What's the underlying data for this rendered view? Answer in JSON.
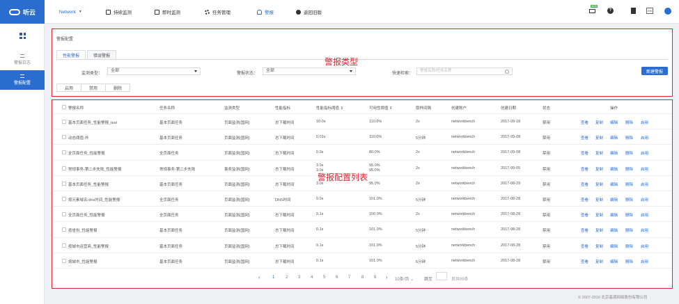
{
  "app": {
    "logo_text": "听云"
  },
  "nav": {
    "network": "Network",
    "continuous": "持续监测",
    "instant": "即时监测",
    "tasks": "任务管理",
    "alerts": "警报",
    "back": "返回旧版"
  },
  "topright": {
    "badge": "NEW",
    "lang": "EN"
  },
  "sidebar": {
    "items": [
      {
        "label": "警报日志"
      },
      {
        "label": "警报配置"
      }
    ]
  },
  "panel": {
    "breadcrumb": "警报配置",
    "tabs": [
      "性能警报",
      "错误警报"
    ],
    "filters": {
      "monitor_type_label": "监测类型：",
      "monitor_type_value": "全部",
      "status_label": "警报状态：",
      "status_value": "全部",
      "quick_search_label": "快速检索：",
      "search_placeholder": "警报名称/任务名称"
    },
    "buttons": {
      "enable": "启用",
      "disable": "禁用",
      "delete": "删除",
      "new": "新建警报"
    },
    "annotation_type": "警报类型",
    "annotation_list": "警报配置列表"
  },
  "table": {
    "headers": [
      "警报名称",
      "任务名称",
      "监测类型",
      "性能指标",
      "性能指标阈值 ⇕",
      "可用性阈值 ⇕",
      "取样间隔",
      "创建账户",
      "创建日期",
      "状态",
      "操作"
    ],
    "ops": [
      "查看",
      "复制",
      "编辑",
      "删除",
      "启用"
    ],
    "rows": [
      {
        "name": "基本页面任务_性能警报_test",
        "task": "基本页面任务",
        "type": "页面监测(国网)",
        "metric": "总下载时间",
        "threshold": "10.0s",
        "avail": "110.0%",
        "interval": "2x",
        "account": "networkbench",
        "date": "2017-09-18",
        "status": "禁用"
      },
      {
        "name": "动态阈值-外",
        "task": "基本页面任务",
        "type": "页面监测(国网)",
        "metric": "总下载时间",
        "threshold": "0.01s",
        "avail": "110.0%",
        "interval": "5分钟",
        "account": "networkbench",
        "date": "2017-09-08",
        "status": "禁用"
      },
      {
        "name": "全页面任务_性能警报",
        "task": "全页面任务",
        "type": "页面监测(国网)",
        "metric": "总下载时间",
        "threshold": "0.0s",
        "avail": "80.0%",
        "interval": "2x",
        "account": "networkbench",
        "date": "2017-09-08",
        "status": "禁用"
      },
      {
        "name": "常规事务-第二步失败_性能警报",
        "task": "常规事务-第二步失败",
        "type": "事务监测(国网)",
        "metric": "总下载时间",
        "threshold": "3.0s",
        "threshold2": "3.0s",
        "avail": "95.0%",
        "avail2": "95.0%",
        "interval": "2x",
        "account": "networkbench",
        "date": "2017-09-05",
        "status": "禁用"
      },
      {
        "name": "基本页面任务_性能警报",
        "task": "基本页面任务",
        "type": "页面监测(国网)",
        "metric": "总下载时间",
        "threshold": "3.0s",
        "avail": "95.0%",
        "interval": "2x",
        "account": "networkbench",
        "date": "2017-08-29",
        "status": "禁用"
      },
      {
        "name": "按元素域名-dns时间_性能警报",
        "task": "全页面任务",
        "type": "页面监测(国网)",
        "metric": "DNS时间",
        "threshold": "0.0s",
        "avail": "101.0%",
        "interval": "5分钟",
        "account": "networkbench",
        "date": "2017-08-28",
        "status": "禁用"
      },
      {
        "name": "全页面任务_性能警报",
        "task": "全页面任务",
        "type": "页面监测(国网)",
        "metric": "总下载时间",
        "threshold": "0.1s",
        "avail": "100.0%",
        "interval": "2x",
        "account": "networkbench",
        "date": "2017-08-28",
        "status": "禁用"
      },
      {
        "name": "按省份_性能警报",
        "task": "基本页面任务",
        "type": "页面监测(国网)",
        "metric": "总下载时间",
        "threshold": "0.1s",
        "avail": "101.0%",
        "interval": "5分钟",
        "account": "networkbench",
        "date": "2017-08-28",
        "status": "禁用"
      },
      {
        "name": "按城市运营商_性能警报",
        "task": "基本页面任务",
        "type": "页面监测(国网)",
        "metric": "总下载时间",
        "threshold": "0.1s",
        "avail": "101.0%",
        "interval": "5分钟",
        "account": "networkbench",
        "date": "2017-08-28",
        "status": "禁用"
      },
      {
        "name": "按城市_性能警报",
        "task": "基本页面任务",
        "type": "页面监测(国网)",
        "metric": "总下载时间",
        "threshold": "0.1s",
        "avail": "101.0%",
        "interval": "5分钟",
        "account": "networkbench",
        "date": "2017-08-28",
        "status": "禁用"
      }
    ]
  },
  "pagination": {
    "prev": "‹",
    "pages": [
      "1",
      "2",
      "3",
      "4",
      "5",
      "6",
      "7",
      "8",
      "9"
    ],
    "next": "›",
    "per_page": "10条/页",
    "jump": "跳至",
    "page_unit": "页共99条"
  },
  "footer": "© 2007-2016 北京基调网络股份有限公司"
}
